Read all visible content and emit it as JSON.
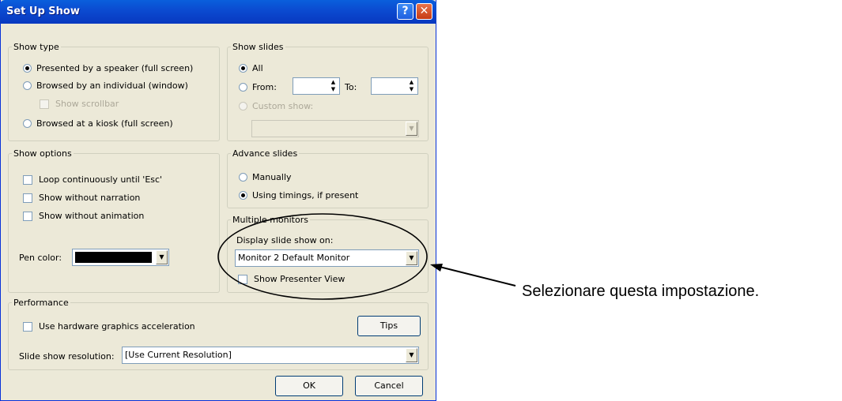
{
  "dialog": {
    "title": "Set Up Show",
    "help_icon": "question-mark-icon",
    "close_icon": "close-x-icon"
  },
  "show_type": {
    "legend": "Show type",
    "options": [
      {
        "label": "Presented by a speaker (full screen)",
        "selected": true
      },
      {
        "label": "Browsed by an individual (window)",
        "selected": false
      },
      {
        "label": "Browsed at a kiosk (full screen)",
        "selected": false
      }
    ],
    "scrollbar_label": "Show scrollbar"
  },
  "show_slides": {
    "legend": "Show slides",
    "all_label": "All",
    "from_label": "From:",
    "to_label": "To:",
    "from_value": "",
    "to_value": "",
    "custom_label": "Custom show:",
    "custom_value": ""
  },
  "show_options": {
    "legend": "Show options",
    "loop_label": "Loop continuously until 'Esc'",
    "no_narration_label": "Show without narration",
    "no_animation_label": "Show without animation",
    "pen_color_label": "Pen color:",
    "pen_color": "#000000"
  },
  "advance_slides": {
    "legend": "Advance slides",
    "manually_label": "Manually",
    "timings_label": "Using timings, if present"
  },
  "multiple_monitors": {
    "legend": "Multiple monitors",
    "display_label": "Display slide show on:",
    "display_value": "Monitor 2 Default Monitor",
    "presenter_view_label": "Show Presenter View"
  },
  "performance": {
    "legend": "Performance",
    "hw_accel_label": "Use hardware graphics acceleration",
    "tips_label": "Tips",
    "resolution_label": "Slide show resolution:",
    "resolution_value": "[Use Current Resolution]"
  },
  "buttons": {
    "ok": "OK",
    "cancel": "Cancel"
  },
  "annotation": {
    "text": "Selezionare questa impostazione."
  }
}
